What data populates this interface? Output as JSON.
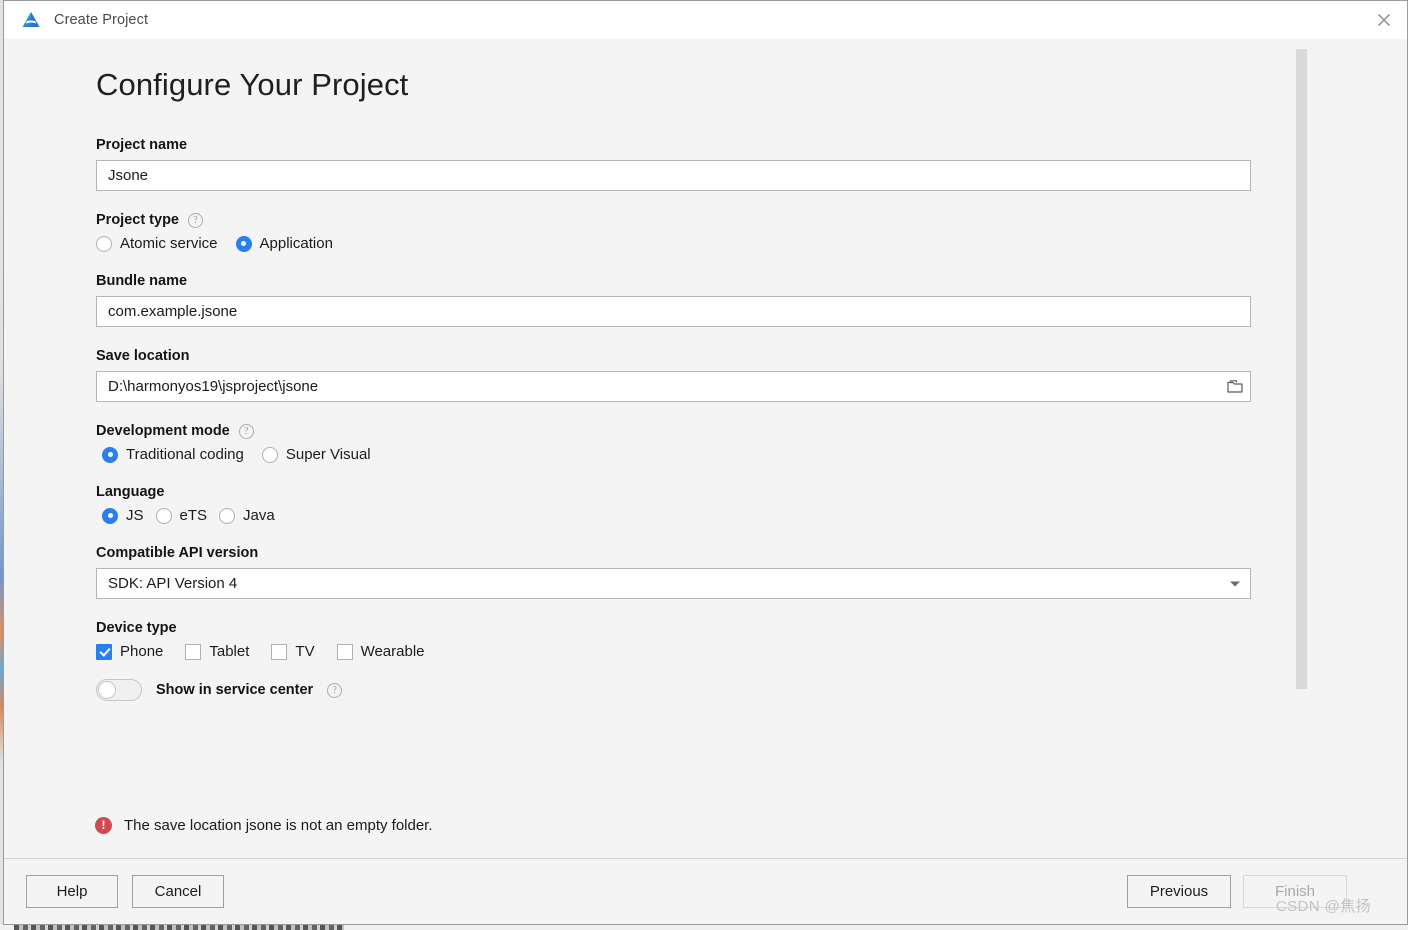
{
  "titlebar": {
    "title": "Create Project",
    "app_icon": "harmonyos-logo-icon",
    "close_icon": "close-icon"
  },
  "page": {
    "heading": "Configure Your Project"
  },
  "fields": {
    "project_name": {
      "label": "Project name",
      "value": "Jsone",
      "placeholder": ""
    },
    "project_type": {
      "label": "Project type",
      "help_icon": "help-icon",
      "options": [
        {
          "label": "Atomic service",
          "checked": false
        },
        {
          "label": "Application",
          "checked": true
        }
      ]
    },
    "bundle_name": {
      "label": "Bundle name",
      "value": "com.example.jsone",
      "placeholder": ""
    },
    "save_location": {
      "label": "Save location",
      "value": "D:\\harmonyos19\\jsproject\\jsone",
      "placeholder": "",
      "browse_icon": "folder-icon"
    },
    "development_mode": {
      "label": "Development mode",
      "help_icon": "help-icon",
      "options": [
        {
          "label": "Traditional coding",
          "checked": true
        },
        {
          "label": "Super Visual",
          "checked": false
        }
      ]
    },
    "language": {
      "label": "Language",
      "options": [
        {
          "label": "JS",
          "checked": true
        },
        {
          "label": "eTS",
          "checked": false
        },
        {
          "label": "Java",
          "checked": false
        }
      ]
    },
    "api_version": {
      "label": "Compatible API version",
      "value": "SDK: API Version 4",
      "dropdown_icon": "chevron-down-icon"
    },
    "device_type": {
      "label": "Device type",
      "options": [
        {
          "label": "Phone",
          "checked": true
        },
        {
          "label": "Tablet",
          "checked": false
        },
        {
          "label": "TV",
          "checked": false
        },
        {
          "label": "Wearable",
          "checked": false
        }
      ]
    },
    "show_in_service_center": {
      "label": "Show in service center",
      "help_icon": "help-icon",
      "enabled": false
    }
  },
  "validation": {
    "icon": "error-icon",
    "symbol": "!",
    "message": "The save location jsone is not an empty folder."
  },
  "footer": {
    "help_label": "Help",
    "cancel_label": "Cancel",
    "previous_label": "Previous",
    "finish_label": "Finish",
    "finish_disabled": true
  },
  "watermark": {
    "text": "CSDN @焦扬"
  },
  "colors": {
    "accent": "#2a7fef",
    "error": "#d04a53",
    "surface": "#f4f4f4",
    "input_bg": "#ffffff",
    "border": "#b5b5b5",
    "scrollbar": "#dadada"
  }
}
